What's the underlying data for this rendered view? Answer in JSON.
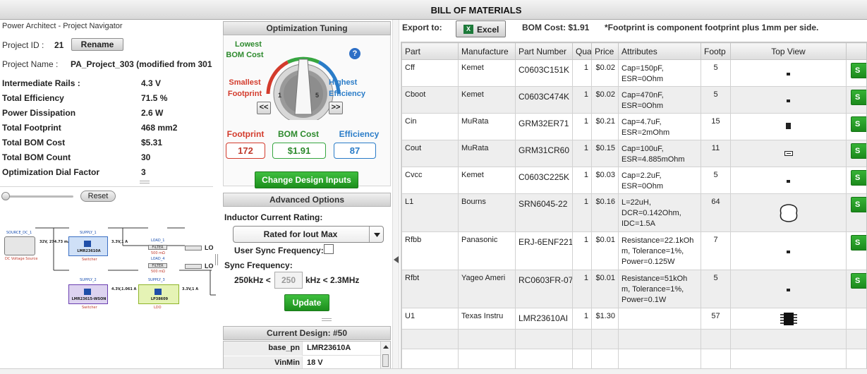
{
  "header": {
    "title": "BILL OF MATERIALS"
  },
  "navigator": {
    "title": "Power Architect - Project Navigator",
    "project_id_label": "Project ID :",
    "project_id": "21",
    "rename_label": "Rename",
    "project_name_label": "Project Name :",
    "project_name": "PA_Project_303 (modified from 301",
    "stats": [
      {
        "label": "Intermediate Rails :",
        "value": "4.3 V"
      },
      {
        "label": "Total Efficiency",
        "value": "71.5 %"
      },
      {
        "label": "Power Dissipation",
        "value": "2.6 W"
      },
      {
        "label": "Total Footprint",
        "value": "468 mm2"
      },
      {
        "label": "Total BOM Cost",
        "value": "$5.31"
      },
      {
        "label": "Total BOM Count",
        "value": "30"
      },
      {
        "label": "Optimization Dial Factor",
        "value": "3"
      }
    ],
    "reset_label": "Reset"
  },
  "schematic": {
    "source_title": "SOURCE_DC_1",
    "source_sub": "DC Voltage Source",
    "source_line": "32V, 274.73 mA",
    "supply1_title": "SUPPLY_1",
    "supply1_part": "LMR23610A",
    "supply1_type": "Switcher",
    "supply1_out": "3.3V,1 A",
    "load1_title": "LOAD_1",
    "load4_title": "LOAD_4",
    "filter_label": "FILTER",
    "filter_val": "500 mΩ",
    "lo_label": "LO",
    "supply2_title": "SUPPLY_2",
    "supply2_part": "LMR23615-WSON",
    "supply2_type": "Switcher",
    "supply2_out": "4.3V,1.061 A",
    "supply3_title": "SUPPLY_3",
    "supply3_part": "LP38609",
    "supply3_type": "LDO",
    "supply3_out": "3.3V,1 A"
  },
  "tuning": {
    "title": "Optimization Tuning",
    "lowest_label": "Lowest",
    "bom_cost_label": "BOM Cost",
    "smallest_label": "Smallest",
    "footprint_label": "Footprint",
    "highest_label": "Highest",
    "efficiency_label": "Efficiency",
    "dial_min": "1",
    "dial_max": "5",
    "dial_value": 3,
    "help_glyph": "?",
    "prev_glyph": "<<",
    "next_glyph": ">>",
    "metric_footprint_label": "Footprint",
    "metric_bom_label": "BOM Cost",
    "metric_eff_label": "Efficiency",
    "metric_footprint_value": "172",
    "metric_bom_value": "$1.91",
    "metric_eff_value": "87",
    "change_inputs_label": "Change Design Inputs"
  },
  "advanced": {
    "title": "Advanced Options",
    "inductor_label": "Inductor Current Rating:",
    "inductor_value": "Rated for Iout Max",
    "sync_freq_label": "User Sync Frequency:",
    "sync_field_label": "Sync Frequency:",
    "sync_min": "250kHz <",
    "sync_value": "250",
    "sync_max": "kHz < 2.3MHz",
    "update_label": "Update"
  },
  "current_design": {
    "title": "Current Design: #50",
    "rows": [
      {
        "key": "base_pn",
        "value": "LMR23610A"
      },
      {
        "key": "VinMin",
        "value": "18 V"
      }
    ]
  },
  "bom": {
    "export_label": "Export to:",
    "excel_label": "Excel",
    "cost_label": "BOM Cost: $1.91",
    "note": "*Footprint is component footprint plus 1mm per side.",
    "columns": [
      "Part",
      "Manufacture",
      "Part Number",
      "Qua",
      "Price",
      "Attributes",
      "Footp",
      "Top View"
    ],
    "select_label": "S",
    "rows": [
      {
        "part": "Cff",
        "mfr": "Kemet",
        "pn": "C0603C151K",
        "qty": "1",
        "price": "$0.02",
        "attrs": "Cap=150pF,\nESR=0Ohm",
        "fp": "5",
        "view": "dot"
      },
      {
        "part": "Cboot",
        "mfr": "Kemet",
        "pn": "C0603C474K",
        "qty": "1",
        "price": "$0.02",
        "attrs": "Cap=470nF,\nESR=0Ohm",
        "fp": "5",
        "view": "dot"
      },
      {
        "part": "Cin",
        "mfr": "MuRata",
        "pn": "GRM32ER71",
        "qty": "1",
        "price": "$0.21",
        "attrs": "Cap=4.7uF,\nESR=2mOhm",
        "fp": "15",
        "view": "square"
      },
      {
        "part": "Cout",
        "mfr": "MuRata",
        "pn": "GRM31CR60",
        "qty": "1",
        "price": "$0.15",
        "attrs": "Cap=100uF,\nESR=4.885mOhm",
        "fp": "11",
        "view": "cap"
      },
      {
        "part": "Cvcc",
        "mfr": "Kemet",
        "pn": "C0603C225K",
        "qty": "1",
        "price": "$0.03",
        "attrs": "Cap=2.2uF,\nESR=0Ohm",
        "fp": "5",
        "view": "dot"
      },
      {
        "part": "L1",
        "mfr": "Bourns",
        "pn": "SRN6045-22",
        "qty": "1",
        "price": "$0.16",
        "attrs": "L=22uH,\nDCR=0.142Ohm,\nIDC=1.5A",
        "fp": "64",
        "view": "inductor"
      },
      {
        "part": "Rfbb",
        "mfr": "Panasonic",
        "pn": "ERJ-6ENF221",
        "qty": "1",
        "price": "$0.01",
        "attrs": "Resistance=22.1kOh\nm, Tolerance=1%,\nPower=0.125W",
        "fp": "7",
        "view": "dot"
      },
      {
        "part": "Rfbt",
        "mfr": "Yageo Ameri",
        "pn": "RC0603FR-07",
        "qty": "1",
        "price": "$0.01",
        "attrs": "Resistance=51kOh\nm, Tolerance=1%,\nPower=0.1W",
        "fp": "5",
        "view": "dot"
      },
      {
        "part": "U1",
        "mfr": "Texas Instru",
        "pn": "LMR23610AI",
        "qty": "1",
        "price": "$1.30",
        "attrs": "",
        "fp": "57",
        "view": "ic"
      }
    ]
  }
}
